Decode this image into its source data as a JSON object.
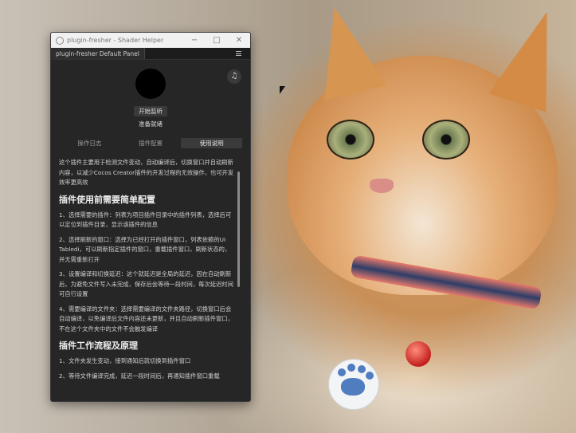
{
  "window": {
    "title": "plugin-fresher - Shader Helper",
    "minimize_icon": "minimize-icon",
    "maximize_icon": "maximize-icon",
    "close_icon": "close-icon",
    "panel_tab": "plugin-fresher Default Panel"
  },
  "panel": {
    "music_icon": "♫",
    "listen_button": "开始监听",
    "status": "准备就绪",
    "tabs": [
      "操作日志",
      "插件配置",
      "使用说明"
    ],
    "active_tab": 2
  },
  "content": {
    "intro": "这个插件主要用于检测文件变动，自动编译后，切换窗口并自动刷新内容，以减少Cocos Creator插件的开发过程的无效操作，也可开发效率更高效",
    "heading1": "插件使用前需要简单配置",
    "items1": [
      "1、选择需要的插件：列表为项目插件目录中的插件列表，选择后可以定位到插件目录，显示该插件的信息",
      "2、选择刷新的窗口：选择为已经打开的插件窗口，列表依赖的UI Tabledi，可以刷新指定插件的窗口，重载插件窗口，刷新状态的，并无需重新打开",
      "3、设置编译和切换延迟：这个就延迟是全局的延迟，因在自动刷新后，为避免文件写入未完成，保存后会等待一段时间，每次延迟时间可自行设置",
      "4、需要编译的文件夹：选择需要编译的文件夹路径，切换窗口后会自动编译，以免编译后文件内容还未更新，并且自动刷新插件窗口，不在这个文件夹中的文件不会触发编译"
    ],
    "heading2": "插件工作流程及原理",
    "items2": [
      "1、文件夹发生变动，接到通知后就切换到插件窗口",
      "2、等待文件编译完成，延迟一段时间后，再通知插件窗口重载"
    ]
  },
  "desktop": {
    "wallpaper": "orange-tabby-cat-photo"
  }
}
